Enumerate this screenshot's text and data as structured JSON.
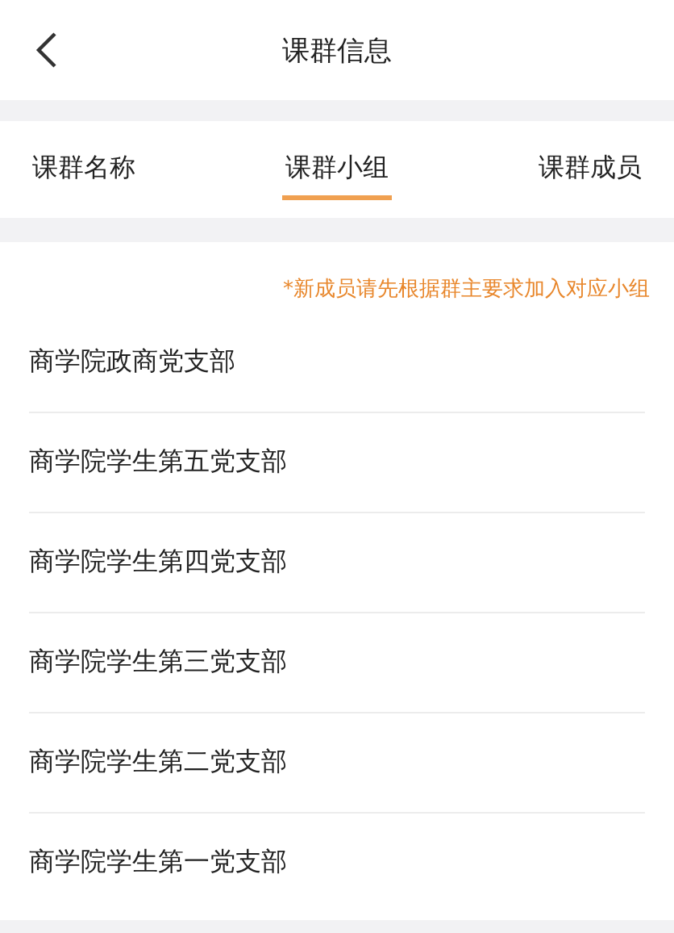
{
  "header": {
    "title": "课群信息"
  },
  "tabs": [
    {
      "label": "课群名称",
      "selected": false
    },
    {
      "label": "课群小组",
      "selected": true
    },
    {
      "label": "课群成员",
      "selected": false
    }
  ],
  "notice": "*新成员请先根据群主要求加入对应小组",
  "groups": [
    "商学院政商党支部",
    "商学院学生第五党支部",
    "商学院学生第四党支部",
    "商学院学生第三党支部",
    "商学院学生第二党支部",
    "商学院学生第一党支部"
  ]
}
